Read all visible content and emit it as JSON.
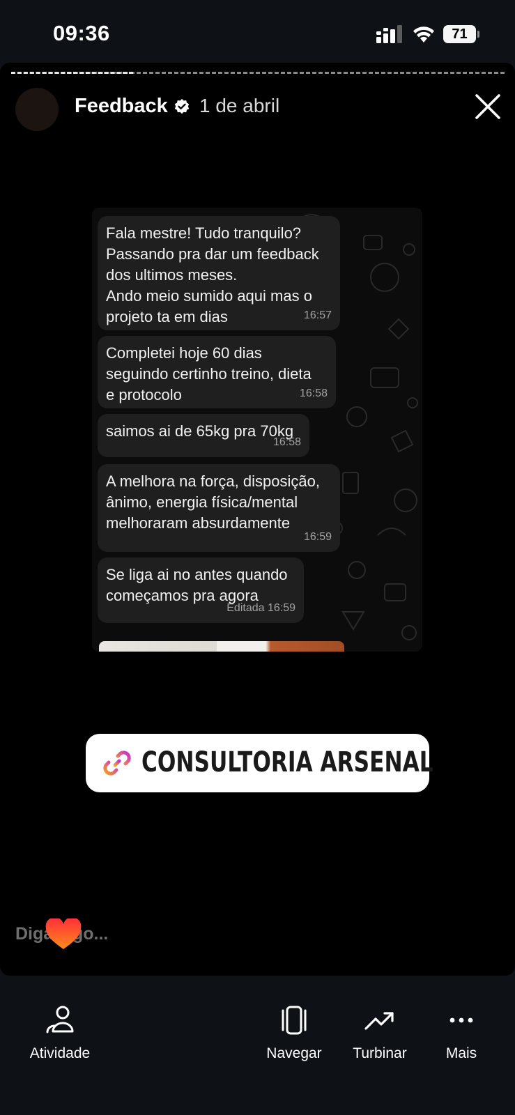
{
  "status_bar": {
    "time": "09:36",
    "battery": "71"
  },
  "story": {
    "account_name": "Feedback",
    "date": "1 de abril",
    "messages": [
      {
        "text": "Fala mestre! Tudo tranquilo?\nPassando pra dar um feedback\ndos ultimos meses.\nAndo meio sumido aqui mas o\nprojeto ta em dias",
        "time": "16:57"
      },
      {
        "text": "Completei hoje 60 dias\nseguindo certinho treino, dieta\ne protocolo",
        "time": "16:58"
      },
      {
        "text": "saimos ai de 65kg pra 70kg",
        "time": "16:58"
      },
      {
        "text": "A melhora na força, disposição,\nânimo, energia física/mental\nmelhoraram absurdamente",
        "time": "16:59"
      },
      {
        "text": "Se liga ai no antes quando\ncomeçamos pra agora",
        "time": "Editada 16:59"
      }
    ],
    "link_sticker": "CONSULTORIA ARSENAL",
    "reply_placeholder": "Diga algo..."
  },
  "bottom_nav": {
    "activity": "Atividade",
    "browse": "Navegar",
    "boost": "Turbinar",
    "more": "Mais"
  },
  "icons": {
    "signal": "signal-icon",
    "wifi": "wifi-icon",
    "verified": "verified-badge-icon",
    "close": "close-icon",
    "link": "link-icon",
    "heart": "heart-icon",
    "activity": "people-icon",
    "browse": "cards-icon",
    "boost": "trending-up-icon",
    "more": "more-dots-icon"
  },
  "colors": {
    "background": "#0e1116",
    "story_bg": "#000000",
    "bubble": "#1f1f1f",
    "link_gradient_start": "#f7a21b",
    "link_gradient_end": "#c72bd6"
  }
}
